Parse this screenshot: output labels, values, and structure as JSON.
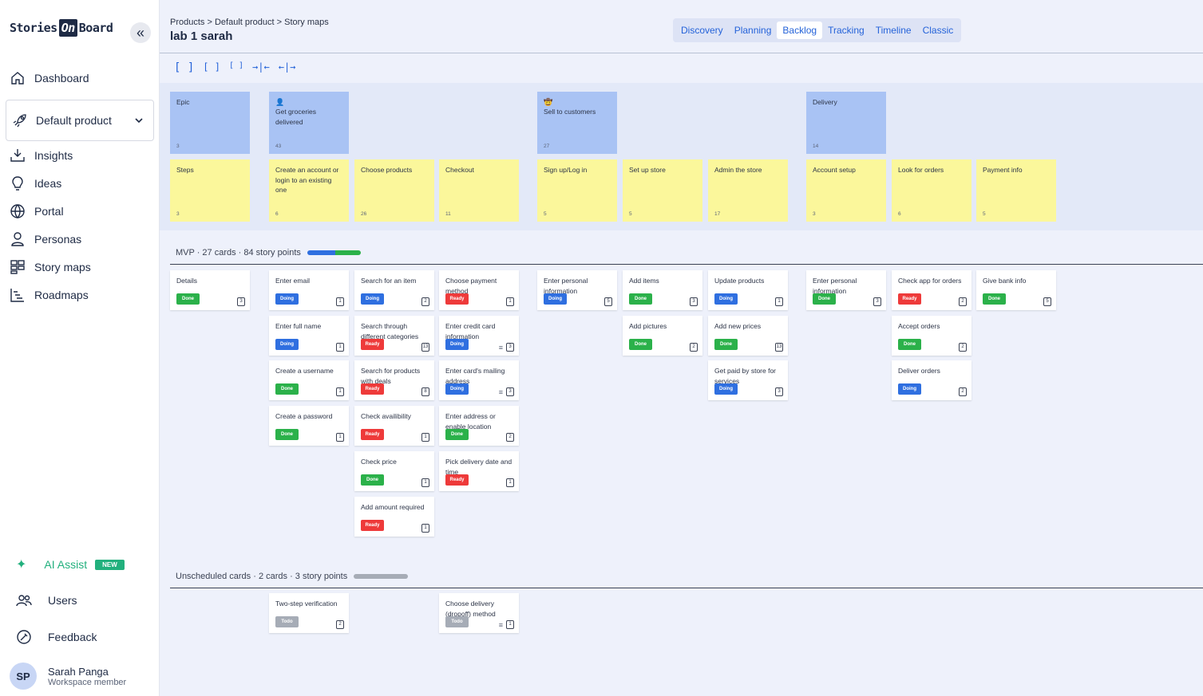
{
  "sidebar": {
    "logo": {
      "a": "Stories",
      "b": "On",
      "c": "Board"
    },
    "nav_top": [
      "Dashboard"
    ],
    "product": "Default product",
    "nav": [
      "Insights",
      "Ideas",
      "Portal",
      "Personas",
      "Story maps",
      "Roadmaps"
    ],
    "ai_label": "AI Assist",
    "ai_badge": "NEW",
    "users": "Users",
    "feedback": "Feedback",
    "user": {
      "initials": "SP",
      "name": "Sarah Panga",
      "role": "Workspace member"
    }
  },
  "header": {
    "breadcrumb": [
      "Products",
      "Default product",
      "Story maps"
    ],
    "title": "lab 1 sarah",
    "tabs": [
      "Discovery",
      "Planning",
      "Backlog",
      "Tracking",
      "Timeline",
      "Classic"
    ],
    "active_tab": "Backlog"
  },
  "epics": [
    {
      "label": "Epic",
      "count": "3",
      "col": 0
    },
    {
      "label": "Get groceries delivered",
      "count": "43",
      "col": 1,
      "persona": "user-icon"
    },
    {
      "label": "Sell to customers",
      "count": "27",
      "col": 4,
      "persona": "hat-icon"
    },
    {
      "label": "Delivery",
      "count": "14",
      "col": 7
    }
  ],
  "steps": [
    {
      "label": "Steps",
      "count": "3"
    },
    {
      "label": "Create an account or login to an existing one",
      "count": "6"
    },
    {
      "label": "Choose products",
      "count": "26"
    },
    {
      "label": "Checkout",
      "count": "11"
    },
    {
      "label": "Sign up/Log in",
      "count": "5"
    },
    {
      "label": "Set up store",
      "count": "5"
    },
    {
      "label": "Admin the store",
      "count": "17"
    },
    {
      "label": "Account setup",
      "count": "3"
    },
    {
      "label": "Look for orders",
      "count": "6"
    },
    {
      "label": "Payment info",
      "count": "5"
    }
  ],
  "releases": [
    {
      "label": "MVP · 27 cards · 84 story points",
      "progress": {
        "doing": 0.52,
        "done": 0.48
      },
      "columns": [
        [
          {
            "t": "Details",
            "s": "Done",
            "p": "3"
          }
        ],
        [
          {
            "t": "Enter email",
            "s": "Doing",
            "p": "1"
          },
          {
            "t": "Enter full name",
            "s": "Doing",
            "p": "1"
          },
          {
            "t": "Create a username",
            "s": "Done",
            "p": "1"
          },
          {
            "t": "Create a password",
            "s": "Done",
            "p": "1"
          }
        ],
        [
          {
            "t": "Search for an item",
            "s": "Doing",
            "p": "2"
          },
          {
            "t": "Search through different categories",
            "s": "Ready",
            "p": "13"
          },
          {
            "t": "Search for products with deals",
            "s": "Ready",
            "p": "8"
          },
          {
            "t": "Check availibility",
            "s": "Ready",
            "p": "1"
          },
          {
            "t": "Check price",
            "s": "Done",
            "p": "1"
          },
          {
            "t": "Add amount required",
            "s": "Ready",
            "p": "1"
          }
        ],
        [
          {
            "t": "Choose payment method",
            "s": "Ready",
            "p": "1"
          },
          {
            "t": "Enter credit card information",
            "s": "Doing",
            "p": "3",
            "m": true
          },
          {
            "t": "Enter card's mailing address",
            "s": "Doing",
            "p": "3",
            "m": true
          },
          {
            "t": "Enter address or enable location",
            "s": "Done",
            "p": "2"
          },
          {
            "t": "Pick delivery date and time",
            "s": "Ready",
            "p": "1"
          }
        ],
        [
          {
            "t": "Enter personal information",
            "s": "Doing",
            "p": "5"
          }
        ],
        [
          {
            "t": "Add items",
            "s": "Done",
            "p": "3"
          },
          {
            "t": "Add pictures",
            "s": "Done",
            "p": "2"
          }
        ],
        [
          {
            "t": "Update products",
            "s": "Doing",
            "p": "1"
          },
          {
            "t": "Add new prices",
            "s": "Done",
            "p": "13"
          },
          {
            "t": "Get paid by store for services",
            "s": "Doing",
            "p": "3"
          }
        ],
        [
          {
            "t": "Enter personal information",
            "s": "Done",
            "p": "3"
          }
        ],
        [
          {
            "t": "Check app for orders",
            "s": "Ready",
            "p": "2"
          },
          {
            "t": "Accept orders",
            "s": "Done",
            "p": "2"
          },
          {
            "t": "Deliver orders",
            "s": "Doing",
            "p": "2"
          }
        ],
        [
          {
            "t": "Give bank info",
            "s": "Done",
            "p": "5"
          }
        ]
      ]
    },
    {
      "label": "Unscheduled cards · 2 cards · 3 story points",
      "progress": {
        "todo": 1.0
      },
      "columns": [
        [],
        [
          {
            "t": "Two-step verification",
            "s": "Todo",
            "p": "2"
          }
        ],
        [],
        [
          {
            "t": "Choose delivery (dropoff) method",
            "s": "Todo",
            "p": "1",
            "m": true
          }
        ],
        [],
        [],
        [],
        [],
        [],
        []
      ]
    }
  ],
  "colors": {
    "done": "#2bb14a",
    "doing": "#2f6fe0",
    "ready": "#ee3a3a",
    "todo": "#a6acb6",
    "epic": "#a9c3f4",
    "step": "#fbf79b",
    "accent": "#2563d9"
  }
}
